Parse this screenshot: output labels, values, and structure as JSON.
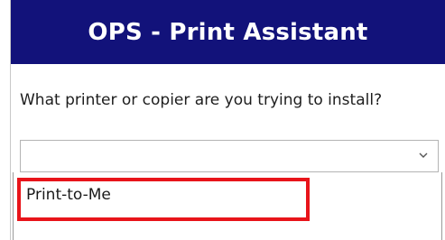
{
  "header": {
    "title": "OPS - Print Assistant"
  },
  "form": {
    "question": "What printer or copier are you trying to install?",
    "select": {
      "selected_value": "",
      "arrow_icon": "chevron-down-icon"
    },
    "dropdown": {
      "options": [
        {
          "label": "Print-to-Me"
        }
      ]
    }
  },
  "annotation": {
    "highlight_color": "#e8141a"
  },
  "colors": {
    "header_background": "#12127a",
    "header_text": "#ffffff"
  }
}
